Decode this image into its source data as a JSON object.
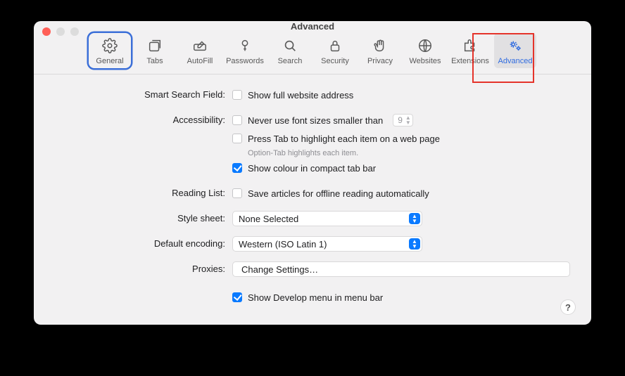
{
  "window": {
    "title": "Advanced"
  },
  "toolbar": {
    "items": [
      {
        "id": "general",
        "label": "General"
      },
      {
        "id": "tabs",
        "label": "Tabs"
      },
      {
        "id": "autofill",
        "label": "AutoFill"
      },
      {
        "id": "passwords",
        "label": "Passwords"
      },
      {
        "id": "search",
        "label": "Search"
      },
      {
        "id": "security",
        "label": "Security"
      },
      {
        "id": "privacy",
        "label": "Privacy"
      },
      {
        "id": "websites",
        "label": "Websites"
      },
      {
        "id": "extensions",
        "label": "Extensions"
      },
      {
        "id": "advanced",
        "label": "Advanced"
      }
    ]
  },
  "sections": {
    "smart_search": {
      "label": "Smart Search Field:",
      "show_full_address": {
        "checked": false,
        "text": "Show full website address"
      }
    },
    "accessibility": {
      "label": "Accessibility:",
      "min_font": {
        "checked": false,
        "text": "Never use font sizes smaller than",
        "value": "9"
      },
      "press_tab": {
        "checked": false,
        "text": "Press Tab to highlight each item on a web page"
      },
      "press_tab_hint": "Option-Tab highlights each item.",
      "compact_colour": {
        "checked": true,
        "text": "Show colour in compact tab bar"
      }
    },
    "reading_list": {
      "label": "Reading List:",
      "offline": {
        "checked": false,
        "text": "Save articles for offline reading automatically"
      }
    },
    "style_sheet": {
      "label": "Style sheet:",
      "value": "None Selected"
    },
    "default_encoding": {
      "label": "Default encoding:",
      "value": "Western (ISO Latin 1)"
    },
    "proxies": {
      "label": "Proxies:",
      "button": "Change Settings…"
    },
    "develop": {
      "checked": true,
      "text": "Show Develop menu in menu bar"
    }
  },
  "help": "?"
}
